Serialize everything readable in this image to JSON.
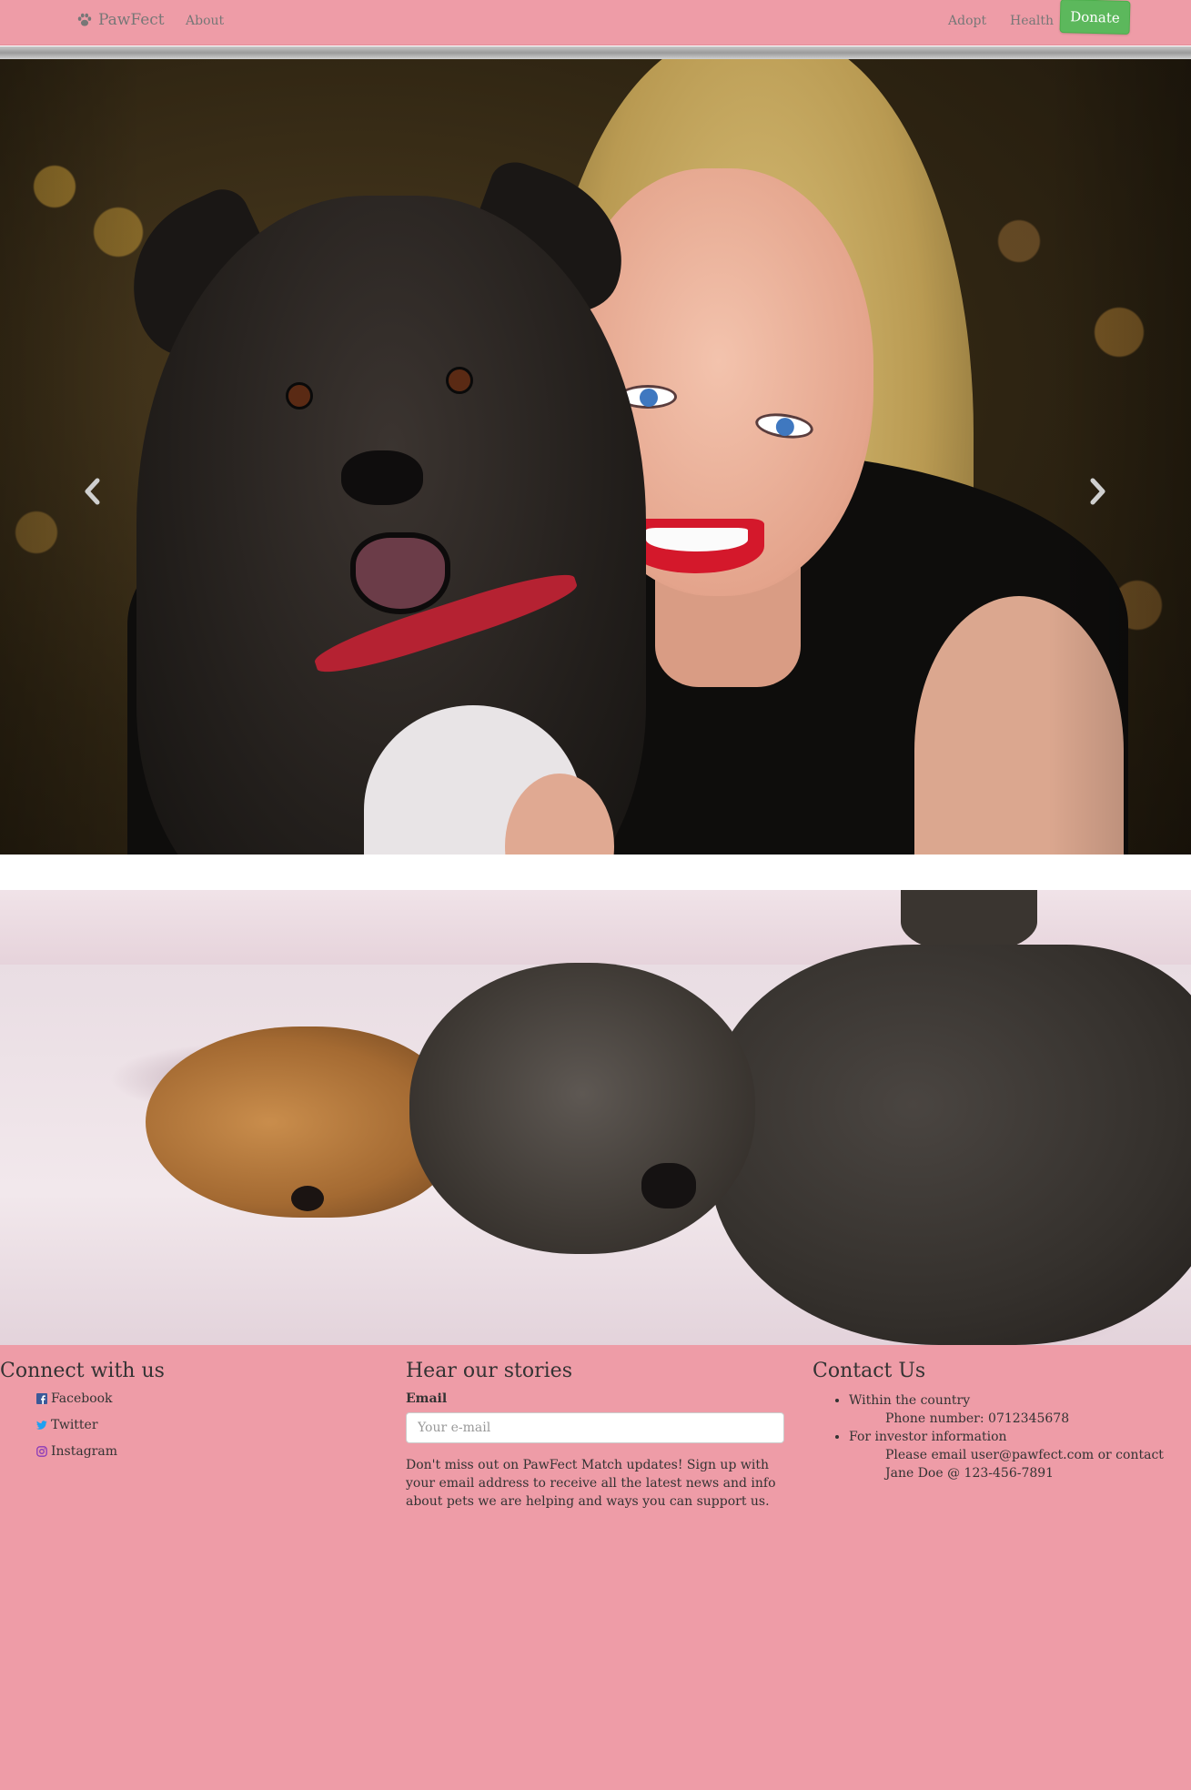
{
  "navbar": {
    "brand": "PawFect",
    "about": "About",
    "adopt": "Adopt",
    "health": "Health",
    "donate": "Donate"
  },
  "carousel": {
    "prev_icon": "chevron-left-icon",
    "next_icon": "chevron-right-icon"
  },
  "footer": {
    "connect": {
      "heading": "Connect with us",
      "links": [
        {
          "label": "Facebook",
          "icon": "facebook-icon"
        },
        {
          "label": "Twitter",
          "icon": "twitter-icon"
        },
        {
          "label": "Instagram",
          "icon": "instagram-icon"
        }
      ]
    },
    "stories": {
      "heading": "Hear our stories",
      "email_label": "Email",
      "email_placeholder": "Your e-mail",
      "text": "Don't miss out on PawFect Match updates! Sign up with your email address to receive all the latest news and info about pets we are helping and ways you can support us."
    },
    "contact": {
      "heading": "Contact Us",
      "items": [
        {
          "title": "Within the country",
          "detail": "Phone number: 0712345678"
        },
        {
          "title": "For investor information",
          "detail": "Please email user@pawfect.com or contact Jane Doe @ 123-456-7891"
        }
      ]
    }
  },
  "colors": {
    "pink": "#ee9ca7",
    "donate_green": "#5cb85c",
    "facebook": "#3b5998",
    "twitter": "#1da1f2"
  }
}
